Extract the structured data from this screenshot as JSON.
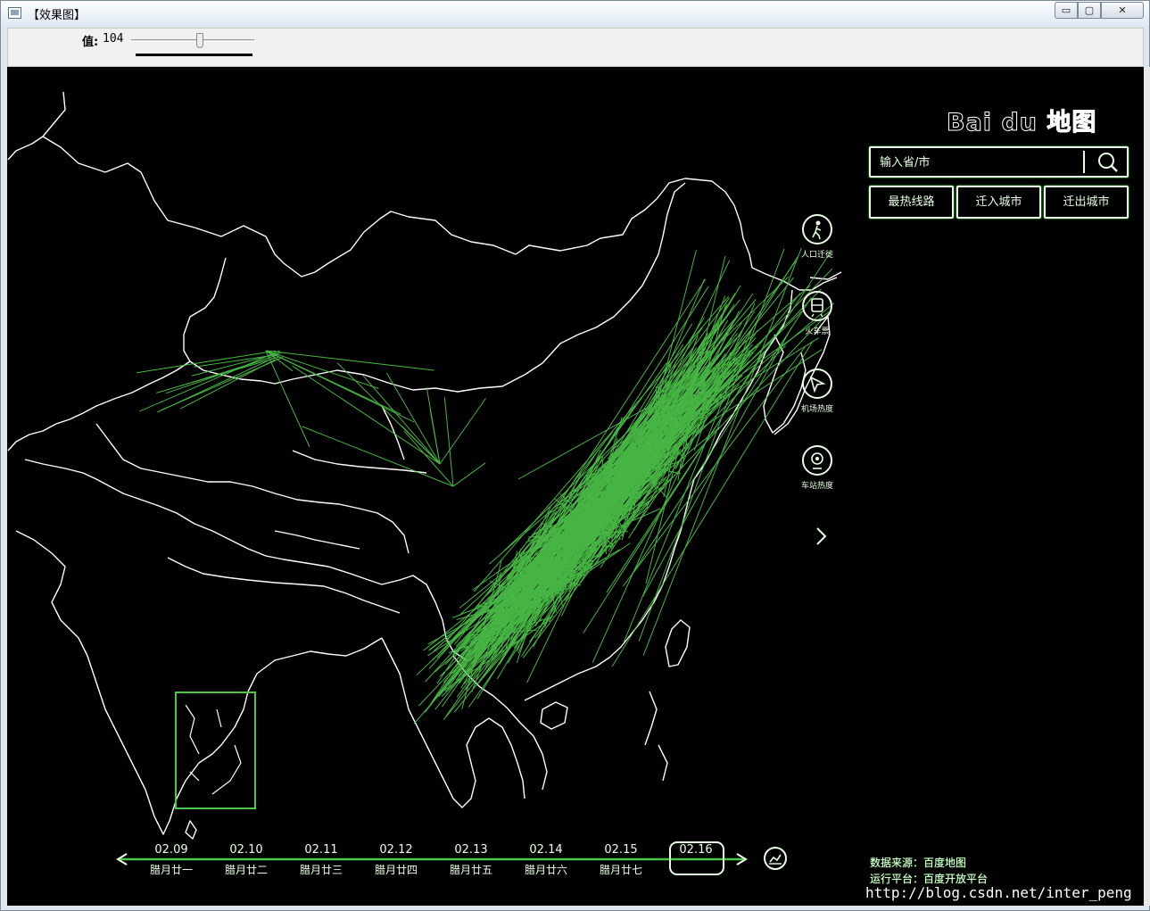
{
  "window": {
    "title": "【效果图】",
    "controls": {
      "minimize": "▭",
      "maximize": "▢",
      "close": "✕"
    }
  },
  "toolbar": {
    "label": "值:",
    "value": "104"
  },
  "overlay": {
    "brand": "Bai du 地图",
    "search": {
      "placeholder": "输入省/市",
      "icon": "search-icon"
    },
    "top_buttons": [
      "最热线路",
      "迁入城市",
      "迁出城市"
    ],
    "side_menu": [
      {
        "label": "人口迁徙",
        "icon": "walker-icon"
      },
      {
        "label": "火车票",
        "icon": "train-icon"
      },
      {
        "label": "机场热度",
        "icon": "plane-icon"
      },
      {
        "label": "车站热度",
        "icon": "station-icon"
      }
    ],
    "timeline": {
      "dates": [
        "02.09",
        "02.10",
        "02.11",
        "02.12",
        "02.13",
        "02.14",
        "02.15",
        "02.16"
      ],
      "lunar": [
        "腊月廿一",
        "腊月廿二",
        "腊月廿三",
        "腊月廿四",
        "腊月廿五",
        "腊月廿六",
        "腊月廿七",
        ""
      ],
      "selected_index": 7
    },
    "footer": {
      "data_source": "数据来源：百度地图",
      "platform": "运行平台：百度开放平台"
    },
    "watermark": "http://blog.csdn.net/inter_peng"
  },
  "colors": {
    "canvas_background": "#000000",
    "edge_lines": "#ffffff",
    "migration_lines": "#4ec44a"
  }
}
